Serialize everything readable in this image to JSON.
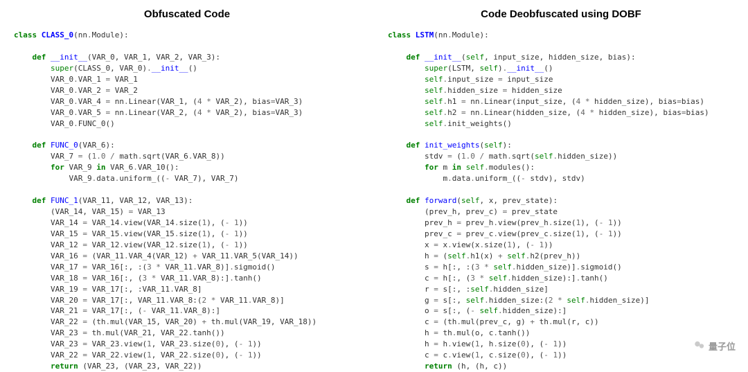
{
  "left": {
    "title": "Obfuscated Code",
    "code_html": "<span class=\"kw\">class</span> <span class=\"cls\">CLASS_0</span>(nn<span class=\"op\">.</span>Module):\n\n    <span class=\"kw\">def</span> <span class=\"fn\">__init__</span>(VAR_0, VAR_1, VAR_2, VAR_3):\n        <span class=\"bi\">super</span>(CLASS_0, VAR_0)<span class=\"op\">.</span><span class=\"fn\">__init__</span>()\n        VAR_0<span class=\"op\">.</span>VAR_1 <span class=\"op\">=</span> VAR_1\n        VAR_0<span class=\"op\">.</span>VAR_2 <span class=\"op\">=</span> VAR_2\n        VAR_0<span class=\"op\">.</span>VAR_4 <span class=\"op\">=</span> nn<span class=\"op\">.</span>Linear(VAR_1, (<span class=\"num\">4</span> <span class=\"op\">*</span> VAR_2), bias<span class=\"op\">=</span>VAR_3)\n        VAR_0<span class=\"op\">.</span>VAR_5 <span class=\"op\">=</span> nn<span class=\"op\">.</span>Linear(VAR_2, (<span class=\"num\">4</span> <span class=\"op\">*</span> VAR_2), bias<span class=\"op\">=</span>VAR_3)\n        VAR_0<span class=\"op\">.</span>FUNC_0()\n\n    <span class=\"kw\">def</span> <span class=\"fn\">FUNC_0</span>(VAR_6):\n        VAR_7 <span class=\"op\">=</span> (<span class=\"num\">1.0</span> <span class=\"op\">/</span> math<span class=\"op\">.</span>sqrt(VAR_6<span class=\"op\">.</span>VAR_8))\n        <span class=\"kw\">for</span> VAR_9 <span class=\"kw\">in</span> VAR_6<span class=\"op\">.</span>VAR_10():\n            VAR_9<span class=\"op\">.</span>data<span class=\"op\">.</span>uniform_((<span class=\"op\">-</span> VAR_7), VAR_7)\n\n    <span class=\"kw\">def</span> <span class=\"fn\">FUNC_1</span>(VAR_11, VAR_12, VAR_13):\n        (VAR_14, VAR_15) <span class=\"op\">=</span> VAR_13\n        VAR_14 <span class=\"op\">=</span> VAR_14<span class=\"op\">.</span>view(VAR_14<span class=\"op\">.</span>size(<span class=\"num\">1</span>), (<span class=\"op\">-</span> <span class=\"num\">1</span>))\n        VAR_15 <span class=\"op\">=</span> VAR_15<span class=\"op\">.</span>view(VAR_15<span class=\"op\">.</span>size(<span class=\"num\">1</span>), (<span class=\"op\">-</span> <span class=\"num\">1</span>))\n        VAR_12 <span class=\"op\">=</span> VAR_12<span class=\"op\">.</span>view(VAR_12<span class=\"op\">.</span>size(<span class=\"num\">1</span>), (<span class=\"op\">-</span> <span class=\"num\">1</span>))\n        VAR_16 <span class=\"op\">=</span> (VAR_11<span class=\"op\">.</span>VAR_4(VAR_12) <span class=\"op\">+</span> VAR_11<span class=\"op\">.</span>VAR_5(VAR_14))\n        VAR_17 <span class=\"op\">=</span> VAR_16[:, :(<span class=\"num\">3</span> <span class=\"op\">*</span> VAR_11<span class=\"op\">.</span>VAR_8)]<span class=\"op\">.</span>sigmoid()\n        VAR_18 <span class=\"op\">=</span> VAR_16[:, (<span class=\"num\">3</span> <span class=\"op\">*</span> VAR_11<span class=\"op\">.</span>VAR_8):]<span class=\"op\">.</span>tanh()\n        VAR_19 <span class=\"op\">=</span> VAR_17[:, :VAR_11<span class=\"op\">.</span>VAR_8]\n        VAR_20 <span class=\"op\">=</span> VAR_17[:, VAR_11<span class=\"op\">.</span>VAR_8:(<span class=\"num\">2</span> <span class=\"op\">*</span> VAR_11<span class=\"op\">.</span>VAR_8)]\n        VAR_21 <span class=\"op\">=</span> VAR_17[:, (<span class=\"op\">-</span> VAR_11<span class=\"op\">.</span>VAR_8):]\n        VAR_22 <span class=\"op\">=</span> (th<span class=\"op\">.</span>mul(VAR_15, VAR_20) <span class=\"op\">+</span> th<span class=\"op\">.</span>mul(VAR_19, VAR_18))\n        VAR_23 <span class=\"op\">=</span> th<span class=\"op\">.</span>mul(VAR_21, VAR_22<span class=\"op\">.</span>tanh())\n        VAR_23 <span class=\"op\">=</span> VAR_23<span class=\"op\">.</span>view(<span class=\"num\">1</span>, VAR_23<span class=\"op\">.</span>size(<span class=\"num\">0</span>), (<span class=\"op\">-</span> <span class=\"num\">1</span>))\n        VAR_22 <span class=\"op\">=</span> VAR_22<span class=\"op\">.</span>view(<span class=\"num\">1</span>, VAR_22<span class=\"op\">.</span>size(<span class=\"num\">0</span>), (<span class=\"op\">-</span> <span class=\"num\">1</span>))\n        <span class=\"kw\">return</span> (VAR_23, (VAR_23, VAR_22))"
  },
  "right": {
    "title": "Code Deobfuscated using DOBF",
    "code_html": "<span class=\"kw\">class</span> <span class=\"cls\">LSTM</span>(nn<span class=\"op\">.</span>Module):\n\n    <span class=\"kw\">def</span> <span class=\"fn\">__init__</span>(<span class=\"self\">self</span>, input_size, hidden_size, bias):\n        <span class=\"bi\">super</span>(LSTM, <span class=\"self\">self</span>)<span class=\"op\">.</span><span class=\"fn\">__init__</span>()\n        <span class=\"self\">self</span><span class=\"op\">.</span>input_size <span class=\"op\">=</span> input_size\n        <span class=\"self\">self</span><span class=\"op\">.</span>hidden_size <span class=\"op\">=</span> hidden_size\n        <span class=\"self\">self</span><span class=\"op\">.</span>h1 <span class=\"op\">=</span> nn<span class=\"op\">.</span>Linear(input_size, (<span class=\"num\">4</span> <span class=\"op\">*</span> hidden_size), bias<span class=\"op\">=</span>bias)\n        <span class=\"self\">self</span><span class=\"op\">.</span>h2 <span class=\"op\">=</span> nn<span class=\"op\">.</span>Linear(hidden_size, (<span class=\"num\">4</span> <span class=\"op\">*</span> hidden_size), bias<span class=\"op\">=</span>bias)\n        <span class=\"self\">self</span><span class=\"op\">.</span>init_weights()\n\n    <span class=\"kw\">def</span> <span class=\"fn\">init_weights</span>(<span class=\"self\">self</span>):\n        stdv <span class=\"op\">=</span> (<span class=\"num\">1.0</span> <span class=\"op\">/</span> math<span class=\"op\">.</span>sqrt(<span class=\"self\">self</span><span class=\"op\">.</span>hidden_size))\n        <span class=\"kw\">for</span> m <span class=\"kw\">in</span> <span class=\"self\">self</span><span class=\"op\">.</span>modules():\n            m<span class=\"op\">.</span>data<span class=\"op\">.</span>uniform_((<span class=\"op\">-</span> stdv), stdv)\n\n    <span class=\"kw\">def</span> <span class=\"fn\">forward</span>(<span class=\"self\">self</span>, x, prev_state):\n        (prev_h, prev_c) <span class=\"op\">=</span> prev_state\n        prev_h <span class=\"op\">=</span> prev_h<span class=\"op\">.</span>view(prev_h<span class=\"op\">.</span>size(<span class=\"num\">1</span>), (<span class=\"op\">-</span> <span class=\"num\">1</span>))\n        prev_c <span class=\"op\">=</span> prev_c<span class=\"op\">.</span>view(prev_c<span class=\"op\">.</span>size(<span class=\"num\">1</span>), (<span class=\"op\">-</span> <span class=\"num\">1</span>))\n        x <span class=\"op\">=</span> x<span class=\"op\">.</span>view(x<span class=\"op\">.</span>size(<span class=\"num\">1</span>), (<span class=\"op\">-</span> <span class=\"num\">1</span>))\n        h <span class=\"op\">=</span> (<span class=\"self\">self</span><span class=\"op\">.</span>h1(x) <span class=\"op\">+</span> <span class=\"self\">self</span><span class=\"op\">.</span>h2(prev_h))\n        s <span class=\"op\">=</span> h[:, :(<span class=\"num\">3</span> <span class=\"op\">*</span> <span class=\"self\">self</span><span class=\"op\">.</span>hidden_size)]<span class=\"op\">.</span>sigmoid()\n        c <span class=\"op\">=</span> h[:, (<span class=\"num\">3</span> <span class=\"op\">*</span> <span class=\"self\">self</span><span class=\"op\">.</span>hidden_size):]<span class=\"op\">.</span>tanh()\n        r <span class=\"op\">=</span> s[:, :<span class=\"self\">self</span><span class=\"op\">.</span>hidden_size]\n        g <span class=\"op\">=</span> s[:, <span class=\"self\">self</span><span class=\"op\">.</span>hidden_size:(<span class=\"num\">2</span> <span class=\"op\">*</span> <span class=\"self\">self</span><span class=\"op\">.</span>hidden_size)]\n        o <span class=\"op\">=</span> s[:, (<span class=\"op\">-</span> <span class=\"self\">self</span><span class=\"op\">.</span>hidden_size):]\n        c <span class=\"op\">=</span> (th<span class=\"op\">.</span>mul(prev_c, g) <span class=\"op\">+</span> th<span class=\"op\">.</span>mul(r, c))\n        h <span class=\"op\">=</span> th<span class=\"op\">.</span>mul(o, c<span class=\"op\">.</span>tanh())\n        h <span class=\"op\">=</span> h<span class=\"op\">.</span>view(<span class=\"num\">1</span>, h<span class=\"op\">.</span>size(<span class=\"num\">0</span>), (<span class=\"op\">-</span> <span class=\"num\">1</span>))\n        c <span class=\"op\">=</span> c<span class=\"op\">.</span>view(<span class=\"num\">1</span>, c<span class=\"op\">.</span>size(<span class=\"num\">0</span>), (<span class=\"op\">-</span> <span class=\"num\">1</span>))\n        <span class=\"kw\">return</span> (h, (h, c))"
  },
  "watermark": "量子位"
}
